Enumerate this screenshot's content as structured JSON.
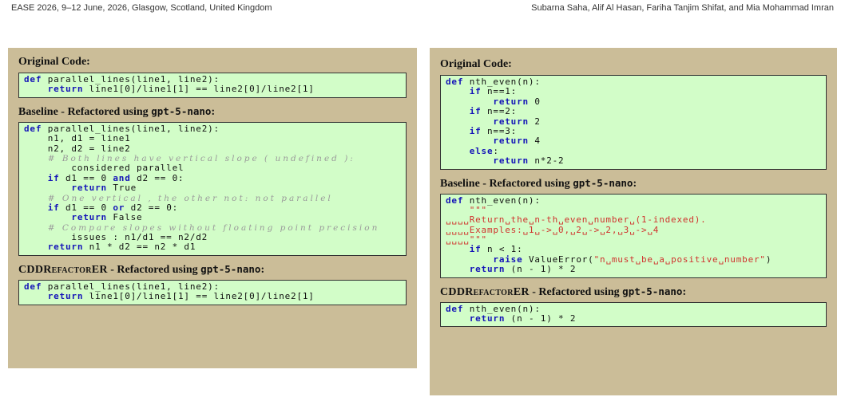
{
  "header": {
    "left": "EASE 2026, 9–12 June, 2026, Glasgow, Scotland, United Kingdom",
    "right": "Subarna Saha, Alif Al Hasan, Fariha Tanjim Shifat, and Mia Mohammad Imran"
  },
  "panels": [
    {
      "original_title": "Original Code:",
      "original_code": [
        "def parallel_lines(line1, line2):",
        "    return line1[0]/line1[1] == line2[0]/line2[1]"
      ],
      "baseline_title_prefix": "Baseline - Refactored using ",
      "baseline_title_model": "gpt-5-nano",
      "baseline_title_suffix": ":",
      "baseline_code": [
        "def parallel_lines(line1, line2):",
        "    n1, d1 = line1",
        "    n2, d2 = line2",
        "    # Both lines have vertical slope ( undefined ):",
        "        considered parallel",
        "    if d1 == 0 and d2 == 0:",
        "        return True",
        "    # One vertical , the other not: not parallel",
        "    if d1 == 0 or d2 == 0:",
        "        return False",
        "    # Compare slopes without floating point precision",
        "        issues : n1/d1 == n2/d2",
        "    return n1 * d2 == n2 * d1"
      ],
      "cdd_title_name": "CDDRefactorER",
      "cdd_title_prefix": " - Refactored using ",
      "cdd_title_model": "gpt-5-nano",
      "cdd_title_suffix": ":",
      "cdd_code": [
        "def parallel_lines(line1, line2):",
        "    return line1[0]/line1[1] == line2[0]/line2[1]"
      ]
    },
    {
      "original_title": "Original Code:",
      "original_code": [
        "def nth_even(n):",
        "    if n==1:",
        "        return 0",
        "    if n==2:",
        "        return 2",
        "    if n==3:",
        "        return 4",
        "    else:",
        "        return n*2-2"
      ],
      "baseline_title_prefix": "Baseline - Refactored using ",
      "baseline_title_model": "gpt-5-nano",
      "baseline_title_suffix": ":",
      "baseline_code": [
        "def nth_even(n):",
        "    \"\"\"",
        "␣␣␣␣Return␣the␣n-th␣even␣number␣(1-indexed).",
        "␣␣␣␣Examples:␣1␣->␣0,␣2␣->␣2,␣3␣->␣4",
        "␣␣␣␣\"\"\"",
        "    if n < 1:",
        "        raise ValueError(\"n␣must␣be␣a␣positive␣number\")",
        "    return (n - 1) * 2"
      ],
      "cdd_title_name": "CDDRefactorER",
      "cdd_title_prefix": " - Refactored using ",
      "cdd_title_model": "gpt-5-nano",
      "cdd_title_suffix": ":",
      "cdd_code": [
        "def nth_even(n):",
        "    return (n - 1) * 2"
      ]
    }
  ]
}
